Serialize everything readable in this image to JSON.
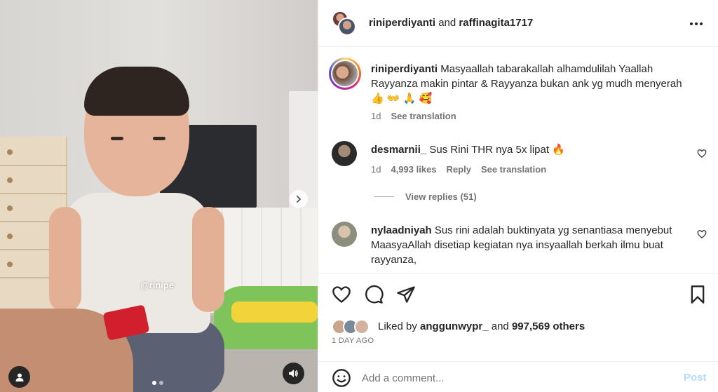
{
  "media": {
    "watermark": "@rinipe",
    "carousel": {
      "current": 1,
      "total": 2
    },
    "icons": {
      "next": "chevron-right-icon",
      "tag": "user-icon",
      "sound": "speaker-icon"
    }
  },
  "header": {
    "user1": "riniperdiyanti",
    "joiner": "and",
    "user2": "raffinagita1717",
    "more_icon": "more-horizontal-icon"
  },
  "caption": {
    "username": "riniperdiyanti",
    "text": "Masyaallah tabarakallah alhamdulilah Yaallah Rayyanza makin pintar & Rayyanza bukan ank yg mudh menyerah 👍 👐 🙏 🥰",
    "time": "1d",
    "translate": "See translation"
  },
  "comments": [
    {
      "username": "desmarnii_",
      "text": "Sus Rini THR nya 5x lipat 🔥",
      "time": "1d",
      "likes": "4,993 likes",
      "reply": "Reply",
      "translate": "See translation",
      "view_replies": "View replies (51)"
    },
    {
      "username": "nylaadniyah",
      "text": "Sus rini adalah buktinyata yg senantiasa menyebut MaasyaAllah disetiap kegiatan nya insyaallah berkah ilmu buat rayyanza,"
    }
  ],
  "likes": {
    "prefix": "Liked by",
    "user": "anggunwypr_",
    "joiner": "and",
    "others": "997,569 others"
  },
  "timeago": "1 DAY AGO",
  "add_comment": {
    "placeholder": "Add a comment...",
    "post_label": "Post"
  },
  "colors": {
    "accent_disabled": "#b3dbff",
    "text": "#262626",
    "muted": "#737373"
  }
}
